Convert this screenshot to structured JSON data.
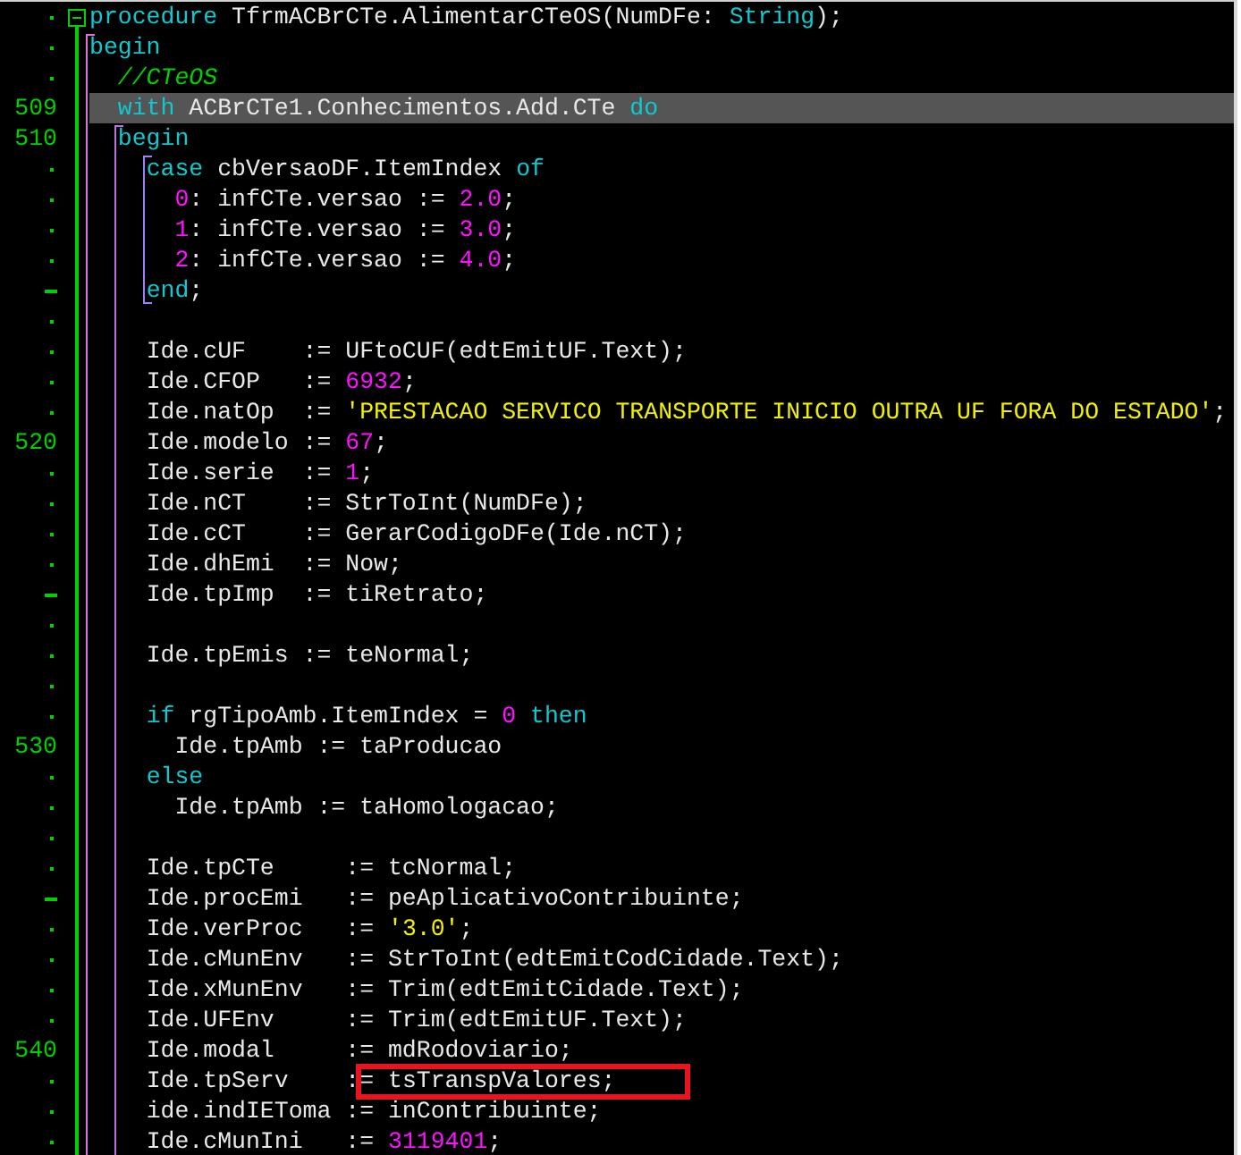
{
  "editor": {
    "lines": [
      {
        "gutter": {
          "kind": "dot"
        },
        "highlighted": false,
        "tokens": [
          {
            "kind": "kw",
            "text": "procedure"
          },
          {
            "kind": "plain",
            "text": " TfrmACBrCTe.AlimentarCTeOS(NumDFe: "
          },
          {
            "kind": "kw",
            "text": "String"
          },
          {
            "kind": "plain",
            "text": ");"
          }
        ]
      },
      {
        "gutter": {
          "kind": "dot"
        },
        "highlighted": false,
        "tokens": [
          {
            "kind": "kw",
            "text": "begin"
          }
        ]
      },
      {
        "gutter": {
          "kind": "dot"
        },
        "highlighted": false,
        "tokens": [
          {
            "kind": "comment",
            "text": "  //CTeOS"
          }
        ]
      },
      {
        "gutter": {
          "kind": "number",
          "text": "509"
        },
        "highlighted": true,
        "tokens": [
          {
            "kind": "kw",
            "text": "  with"
          },
          {
            "kind": "plain",
            "text": " ACBrCTe1.Conhecimentos.Add.CTe "
          },
          {
            "kind": "kw",
            "text": "do"
          }
        ]
      },
      {
        "gutter": {
          "kind": "number",
          "text": "510"
        },
        "highlighted": false,
        "tokens": [
          {
            "kind": "kw",
            "text": "  begin"
          }
        ]
      },
      {
        "gutter": {
          "kind": "dot"
        },
        "highlighted": false,
        "tokens": [
          {
            "kind": "kw",
            "text": "    case"
          },
          {
            "kind": "plain",
            "text": " cbVersaoDF.ItemIndex "
          },
          {
            "kind": "kw",
            "text": "of"
          }
        ]
      },
      {
        "gutter": {
          "kind": "dot"
        },
        "highlighted": false,
        "tokens": [
          {
            "kind": "num",
            "text": "      0"
          },
          {
            "kind": "plain",
            "text": ": infCTe.versao := "
          },
          {
            "kind": "num",
            "text": "2.0"
          },
          {
            "kind": "plain",
            "text": ";"
          }
        ]
      },
      {
        "gutter": {
          "kind": "dot"
        },
        "highlighted": false,
        "tokens": [
          {
            "kind": "num",
            "text": "      1"
          },
          {
            "kind": "plain",
            "text": ": infCTe.versao := "
          },
          {
            "kind": "num",
            "text": "3.0"
          },
          {
            "kind": "plain",
            "text": ";"
          }
        ]
      },
      {
        "gutter": {
          "kind": "dot"
        },
        "highlighted": false,
        "tokens": [
          {
            "kind": "num",
            "text": "      2"
          },
          {
            "kind": "plain",
            "text": ": infCTe.versao := "
          },
          {
            "kind": "num",
            "text": "4.0"
          },
          {
            "kind": "plain",
            "text": ";"
          }
        ]
      },
      {
        "gutter": {
          "kind": "dash"
        },
        "highlighted": false,
        "tokens": [
          {
            "kind": "kw",
            "text": "    end"
          },
          {
            "kind": "plain",
            "text": ";"
          }
        ]
      },
      {
        "gutter": {
          "kind": "dot"
        },
        "highlighted": false
      },
      {
        "gutter": {
          "kind": "dot"
        },
        "highlighted": false,
        "tokens": [
          {
            "kind": "plain",
            "text": "    Ide.cUF    := UFtoCUF(edtEmitUF.Text);"
          }
        ]
      },
      {
        "gutter": {
          "kind": "dot"
        },
        "highlighted": false,
        "tokens": [
          {
            "kind": "plain",
            "text": "    Ide.CFOP   := "
          },
          {
            "kind": "num",
            "text": "6932"
          },
          {
            "kind": "plain",
            "text": ";"
          }
        ]
      },
      {
        "gutter": {
          "kind": "dot"
        },
        "highlighted": false,
        "tokens": [
          {
            "kind": "plain",
            "text": "    Ide.natOp  := "
          },
          {
            "kind": "str",
            "text": "'PRESTACAO SERVICO TRANSPORTE INICIO OUTRA UF FORA DO ESTADO'"
          },
          {
            "kind": "plain",
            "text": ";"
          }
        ]
      },
      {
        "gutter": {
          "kind": "number",
          "text": "520"
        },
        "highlighted": false,
        "tokens": [
          {
            "kind": "plain",
            "text": "    Ide.modelo := "
          },
          {
            "kind": "num",
            "text": "67"
          },
          {
            "kind": "plain",
            "text": ";"
          }
        ]
      },
      {
        "gutter": {
          "kind": "dot"
        },
        "highlighted": false,
        "tokens": [
          {
            "kind": "plain",
            "text": "    Ide.serie  := "
          },
          {
            "kind": "num",
            "text": "1"
          },
          {
            "kind": "plain",
            "text": ";"
          }
        ]
      },
      {
        "gutter": {
          "kind": "dot"
        },
        "highlighted": false,
        "tokens": [
          {
            "kind": "plain",
            "text": "    Ide.nCT    := StrToInt(NumDFe);"
          }
        ]
      },
      {
        "gutter": {
          "kind": "dot"
        },
        "highlighted": false,
        "tokens": [
          {
            "kind": "plain",
            "text": "    Ide.cCT    := GerarCodigoDFe(Ide.nCT);"
          }
        ]
      },
      {
        "gutter": {
          "kind": "dot"
        },
        "highlighted": false,
        "tokens": [
          {
            "kind": "plain",
            "text": "    Ide.dhEmi  := Now;"
          }
        ]
      },
      {
        "gutter": {
          "kind": "dash"
        },
        "highlighted": false,
        "tokens": [
          {
            "kind": "plain",
            "text": "    Ide.tpImp  := tiRetrato;"
          }
        ]
      },
      {
        "gutter": {
          "kind": "dot"
        },
        "highlighted": false
      },
      {
        "gutter": {
          "kind": "dot"
        },
        "highlighted": false,
        "tokens": [
          {
            "kind": "plain",
            "text": "    Ide.tpEmis := teNormal;"
          }
        ]
      },
      {
        "gutter": {
          "kind": "dot"
        },
        "highlighted": false
      },
      {
        "gutter": {
          "kind": "dot"
        },
        "highlighted": false,
        "tokens": [
          {
            "kind": "kw",
            "text": "    if"
          },
          {
            "kind": "plain",
            "text": " rgTipoAmb.ItemIndex = "
          },
          {
            "kind": "num",
            "text": "0"
          },
          {
            "kind": "kw",
            "text": " then"
          }
        ]
      },
      {
        "gutter": {
          "kind": "number",
          "text": "530"
        },
        "highlighted": false,
        "tokens": [
          {
            "kind": "plain",
            "text": "      Ide.tpAmb := taProducao"
          }
        ]
      },
      {
        "gutter": {
          "kind": "dot"
        },
        "highlighted": false,
        "tokens": [
          {
            "kind": "kw",
            "text": "    else"
          }
        ]
      },
      {
        "gutter": {
          "kind": "dot"
        },
        "highlighted": false,
        "tokens": [
          {
            "kind": "plain",
            "text": "      Ide.tpAmb := taHomologacao;"
          }
        ]
      },
      {
        "gutter": {
          "kind": "dot"
        },
        "highlighted": false
      },
      {
        "gutter": {
          "kind": "dot"
        },
        "highlighted": false,
        "tokens": [
          {
            "kind": "plain",
            "text": "    Ide.tpCTe     := tcNormal;"
          }
        ]
      },
      {
        "gutter": {
          "kind": "dash"
        },
        "highlighted": false,
        "tokens": [
          {
            "kind": "plain",
            "text": "    Ide.procEmi   := peAplicativoContribuinte;"
          }
        ]
      },
      {
        "gutter": {
          "kind": "dot"
        },
        "highlighted": false,
        "tokens": [
          {
            "kind": "plain",
            "text": "    Ide.verProc   := "
          },
          {
            "kind": "str",
            "text": "'3.0'"
          },
          {
            "kind": "plain",
            "text": ";"
          }
        ]
      },
      {
        "gutter": {
          "kind": "dot"
        },
        "highlighted": false,
        "tokens": [
          {
            "kind": "plain",
            "text": "    Ide.cMunEnv   := StrToInt(edtEmitCodCidade.Text);"
          }
        ]
      },
      {
        "gutter": {
          "kind": "dot"
        },
        "highlighted": false,
        "tokens": [
          {
            "kind": "plain",
            "text": "    Ide.xMunEnv   := Trim(edtEmitCidade.Text);"
          }
        ]
      },
      {
        "gutter": {
          "kind": "dot"
        },
        "highlighted": false,
        "tokens": [
          {
            "kind": "plain",
            "text": "    Ide.UFEnv     := Trim(edtEmitUF.Text);"
          }
        ]
      },
      {
        "gutter": {
          "kind": "number",
          "text": "540"
        },
        "highlighted": false,
        "tokens": [
          {
            "kind": "plain",
            "text": "    Ide.modal     := mdRodoviario;"
          }
        ]
      },
      {
        "gutter": {
          "kind": "dot"
        },
        "highlighted": false,
        "tokens": [
          {
            "kind": "plain",
            "text": "    Ide.tpServ    :"
          },
          {
            "kind": "plain",
            "text": "= tsTranspValores;",
            "boxed": true
          }
        ]
      },
      {
        "gutter": {
          "kind": "dot"
        },
        "highlighted": false,
        "tokens": [
          {
            "kind": "plain",
            "text": "    ide.indIEToma := inContribuinte;"
          }
        ]
      },
      {
        "gutter": {
          "kind": "dot"
        },
        "highlighted": false,
        "tokens": [
          {
            "kind": "plain",
            "text": "    Ide.cMunIni   := "
          },
          {
            "kind": "num",
            "text": "3119401"
          },
          {
            "kind": "plain",
            "text": ";"
          }
        ]
      }
    ]
  }
}
